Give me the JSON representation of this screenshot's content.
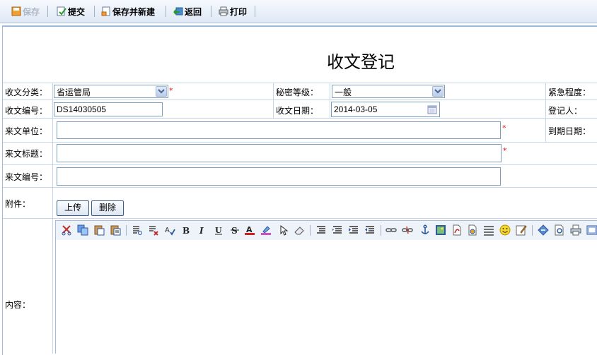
{
  "toolbar": {
    "save": "保存",
    "submit": "提交",
    "save_new": "保存并新建",
    "back": "返回",
    "print": "打印"
  },
  "page_title": "收文登记",
  "form": {
    "category_label": "收文分类：",
    "category_value": "省运管局",
    "secret_label": "秘密等级：",
    "secret_value": "一般",
    "urgency_label": "紧急程度：",
    "doc_no_label": "收文编号：",
    "doc_no_value": "DS14030505",
    "date_label": "收文日期：",
    "date_value": "2014-03-05",
    "registrar_label": "登记人：",
    "unit_label": "来文单位：",
    "due_label": "到期日期：",
    "subject_label": "来文标题：",
    "incoming_no_label": "来文编号：",
    "attachment_label": "附件：",
    "upload_button": "上传",
    "delete_button": "删除",
    "content_label": "内容：",
    "required_mark": "*"
  }
}
